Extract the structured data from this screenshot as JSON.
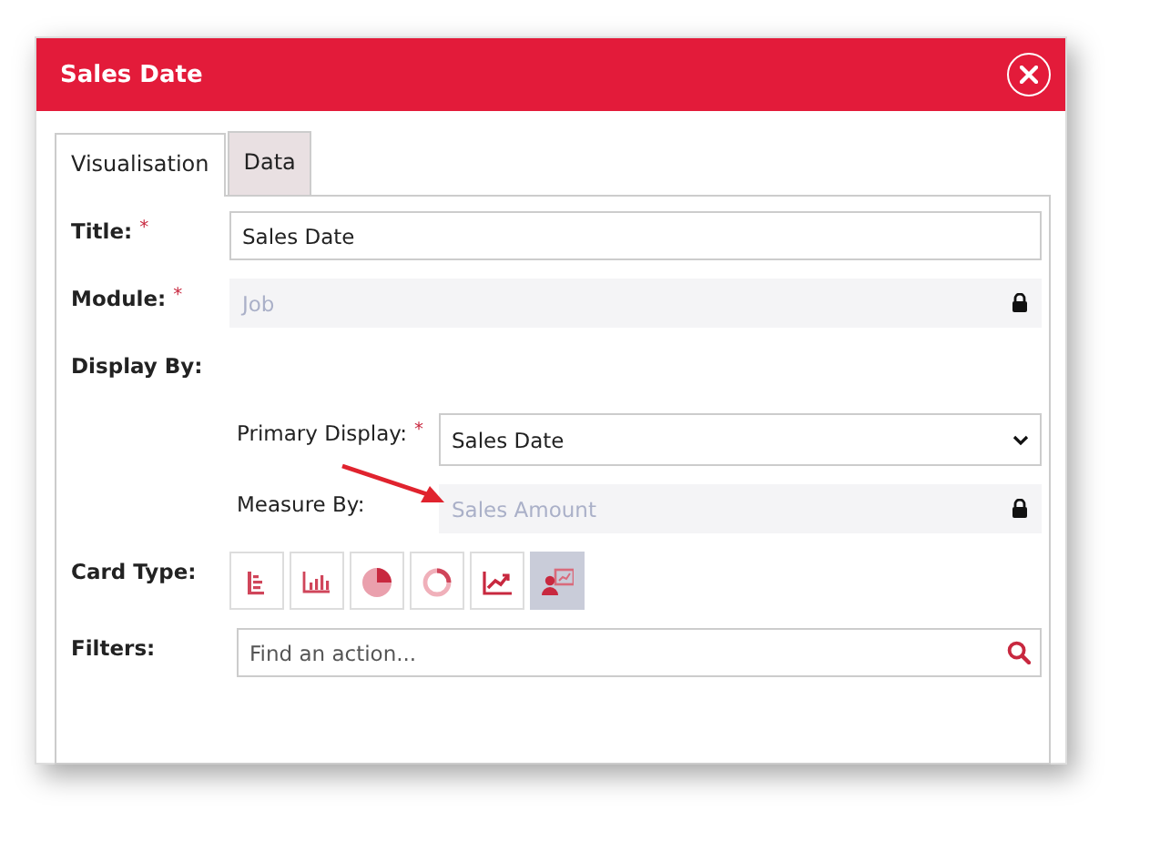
{
  "dialog": {
    "title": "Sales Date"
  },
  "tabs": [
    {
      "label": "Visualisation",
      "selected": true
    },
    {
      "label": "Data",
      "selected": false
    }
  ],
  "fields": [
    {
      "kind": "text",
      "label": "Title:",
      "required_mark": "*",
      "value": "Sales Date"
    },
    {
      "kind": "locked",
      "label": "Module:",
      "required_mark": "*",
      "value": "Job"
    }
  ],
  "display_by": {
    "label": "Display By:",
    "primary": {
      "label": "Primary Display:",
      "required_mark": "*",
      "value": "Sales Date"
    },
    "measure": {
      "label": "Measure By:",
      "value": "Sales Amount"
    }
  },
  "card_type": {
    "label": "Card Type:",
    "options": [
      {
        "kind": "list",
        "selected": false
      },
      {
        "kind": "bar",
        "selected": false
      },
      {
        "kind": "pie",
        "selected": false
      },
      {
        "kind": "donut",
        "selected": false
      },
      {
        "kind": "line",
        "selected": false
      },
      {
        "kind": "kpi",
        "selected": true
      }
    ]
  },
  "filters": {
    "label": "Filters:",
    "placeholder": "Find an action..."
  }
}
